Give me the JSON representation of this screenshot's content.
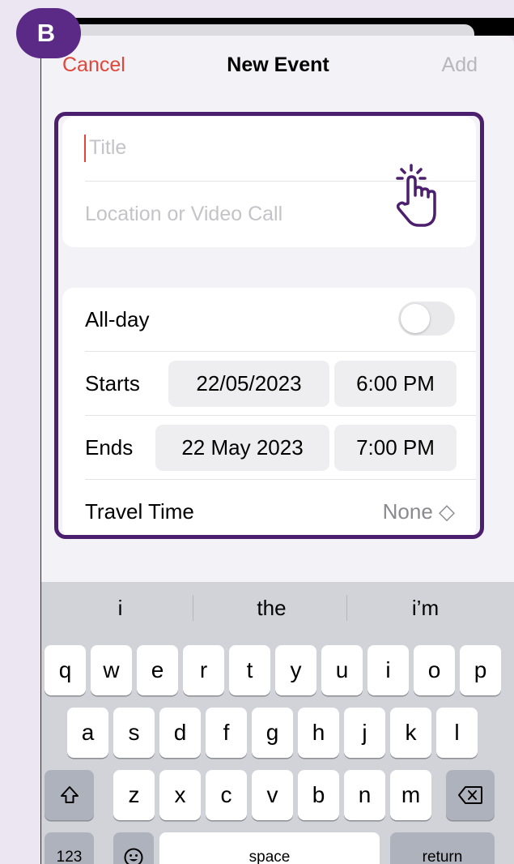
{
  "badge": "B",
  "nav": {
    "cancel": "Cancel",
    "title": "New Event",
    "add": "Add"
  },
  "fields": {
    "title_placeholder": "Title",
    "location_placeholder": "Location or Video Call"
  },
  "allday": {
    "label": "All-day",
    "on": false
  },
  "starts": {
    "label": "Starts",
    "date": "22/05/2023",
    "time": "6:00 PM"
  },
  "ends": {
    "label": "Ends",
    "date": "22 May 2023",
    "time": "7:00 PM"
  },
  "travel": {
    "label": "Travel Time",
    "value": "None ◇"
  },
  "colors": {
    "accent": "#e0473a",
    "highlight": "#4c1f6e",
    "badge": "#5b2a86"
  },
  "icons": {
    "tap": "tap-hand-icon",
    "shift": "shift-icon",
    "delete": "delete-icon",
    "emoji": "emoji-icon"
  },
  "keyboard": {
    "suggestions": [
      "i",
      "the",
      "i’m"
    ],
    "row1": [
      "q",
      "w",
      "e",
      "r",
      "t",
      "y",
      "u",
      "i",
      "o",
      "p"
    ],
    "row2": [
      "a",
      "s",
      "d",
      "f",
      "g",
      "h",
      "j",
      "k",
      "l"
    ],
    "row3": [
      "z",
      "x",
      "c",
      "v",
      "b",
      "n",
      "m"
    ],
    "numbers": "123",
    "space": "space",
    "return": "return"
  }
}
